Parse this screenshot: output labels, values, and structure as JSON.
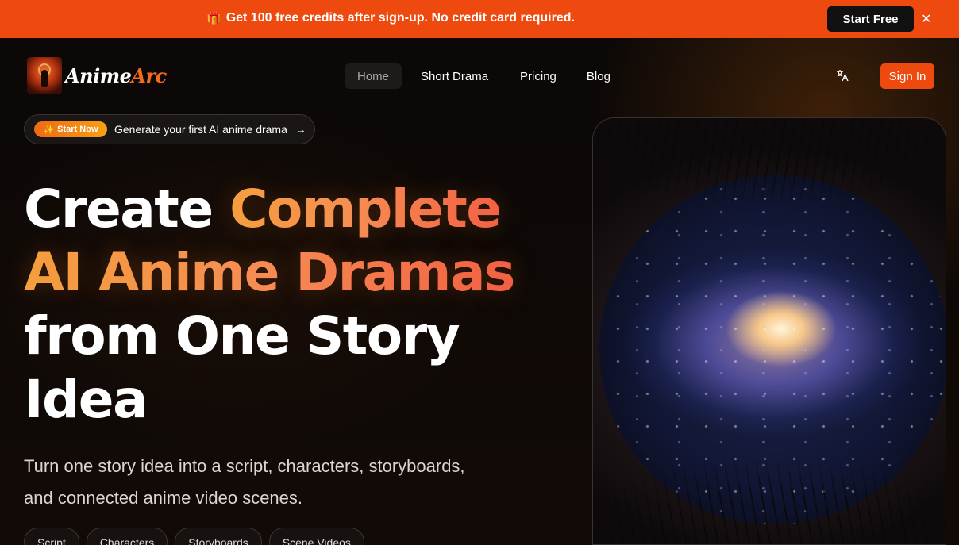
{
  "promo": {
    "gift_icon": "gift-icon",
    "text": "Get 100 free credits after sign-up. No credit card required.",
    "cta": "Start Free",
    "close_icon": "close-icon"
  },
  "brand": {
    "name_part1": "Anime",
    "name_part2": "Arc"
  },
  "nav": {
    "items": [
      {
        "label": "Home",
        "active": true
      },
      {
        "label": "Short Drama"
      },
      {
        "label": "Pricing"
      },
      {
        "label": "Blog"
      }
    ],
    "language_icon": "translate-icon",
    "sign_in": "Sign In"
  },
  "announcement": {
    "badge": "Start Now",
    "badge_icon": "sparkle-icon",
    "text": "Generate your first AI anime drama",
    "arrow_icon": "arrow-right-icon"
  },
  "hero": {
    "headline_1a": "Create ",
    "headline_1b": "Complete",
    "headline_2": "AI Anime Dramas",
    "headline_3": "from One Story",
    "headline_4": "Idea",
    "subtitle": "Turn one story idea into a script, characters, storyboards, and connected anime video scenes.",
    "tags": [
      "Script",
      "Characters",
      "Storyboards",
      "Scene Videos"
    ]
  },
  "colors": {
    "accent": "#ee4a10",
    "gradient_start": "#f6a340",
    "gradient_end": "#f45f48",
    "background": "#0a0706"
  }
}
